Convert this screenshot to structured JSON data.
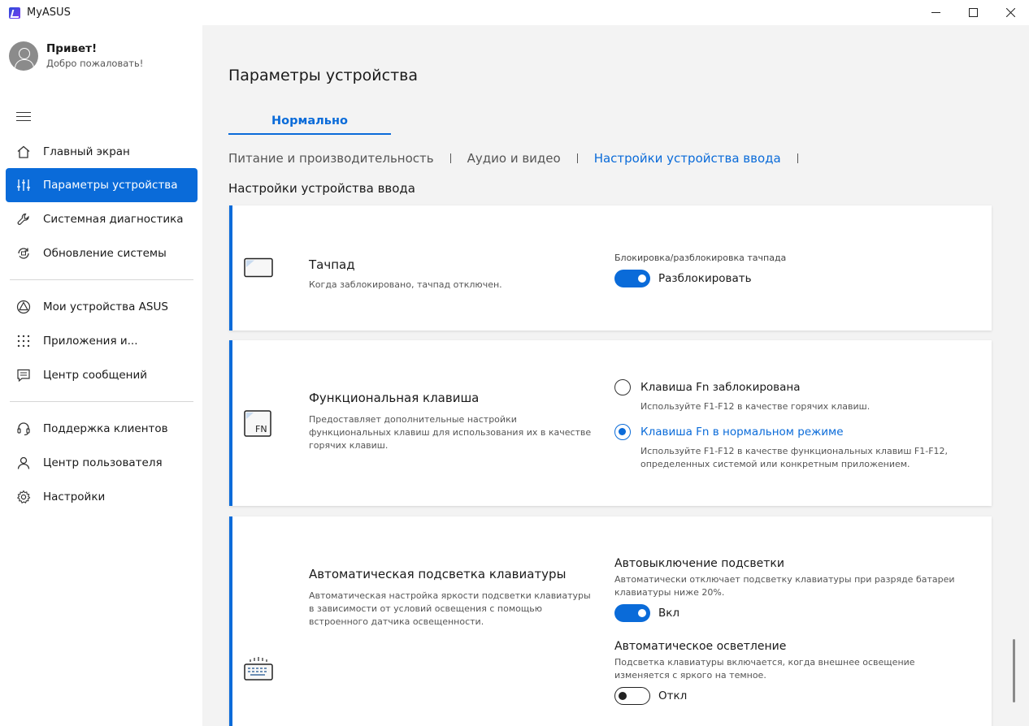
{
  "window": {
    "title": "MyASUS",
    "controls": [
      "minimize",
      "maximize",
      "close"
    ]
  },
  "sidebar": {
    "greeting": "Привет!",
    "welcome": "Добро пожаловать!",
    "items": [
      {
        "label": "Главный экран",
        "icon": "home-icon"
      },
      {
        "label": "Параметры устройства",
        "icon": "sliders-icon",
        "active": true
      },
      {
        "label": "Системная диагностика",
        "icon": "wrench-icon"
      },
      {
        "label": "Обновление системы",
        "icon": "update-icon"
      },
      {
        "label": "Мои устройства ASUS",
        "icon": "devices-icon"
      },
      {
        "label": "Приложения и...",
        "icon": "apps-grid-icon"
      },
      {
        "label": "Центр сообщений",
        "icon": "message-icon"
      },
      {
        "label": "Поддержка клиентов",
        "icon": "headset-icon"
      },
      {
        "label": "Центр пользователя",
        "icon": "user-icon"
      },
      {
        "label": "Настройки",
        "icon": "gear-icon"
      }
    ]
  },
  "main": {
    "page_title": "Параметры устройства",
    "mode_tab": "Нормально",
    "subtabs": [
      {
        "label": "Питание и производительность",
        "active": false
      },
      {
        "label": "Аудио и видео",
        "active": false
      },
      {
        "label": "Настройки устройства ввода",
        "active": true
      }
    ],
    "section_title": "Настройки устройства ввода",
    "cards": {
      "touchpad": {
        "icon": "touchpad-icon",
        "title": "Тачпад",
        "description": "Когда заблокировано, тачпад отключен.",
        "control_caption": "Блокировка/разблокировка тачпада",
        "toggle_on": true,
        "toggle_label": "Разблокировать"
      },
      "fn_key": {
        "icon": "fn-key-icon",
        "icon_text": "FN",
        "title": "Функциональная клавиша",
        "description": "Предоставляет дополнительные настройки функциональных клавиш для использования их в качестве горячих клавиш.",
        "options": [
          {
            "label": "Клавиша Fn заблокирована",
            "description": "Используйте F1-F12 в качестве горячих клавиш.",
            "checked": false
          },
          {
            "label": "Клавиша Fn в нормальном режиме",
            "description": "Используйте F1-F12 в качестве функциональных клавиш F1-F12, определенных системой или конкретным приложением.",
            "checked": true
          }
        ]
      },
      "backlight": {
        "icon": "keyboard-backlight-icon",
        "title": "Автоматическая подсветка клавиатуры",
        "description": "Автоматическая настройка яркости подсветки клавиатуры в зависимости от условий освещения с помощью встроенного датчика освещенности.",
        "auto_off": {
          "title": "Автовыключение подсветки",
          "description": "Автоматически отключает подсветку клавиатуры при разряде батареи клавиатуры ниже 20%.",
          "toggle_on": true,
          "toggle_label": "Вкл"
        },
        "auto_light": {
          "title": "Автоматическое осветление",
          "description": "Подсветка клавиатуры включается, когда внешнее освещение изменяется с яркого на темное.",
          "toggle_on": false,
          "toggle_label": "Откл"
        }
      }
    }
  },
  "colors": {
    "accent": "#0a6bd9",
    "sidebar_bg": "#ffffff",
    "main_bg": "#f3f3f3"
  }
}
